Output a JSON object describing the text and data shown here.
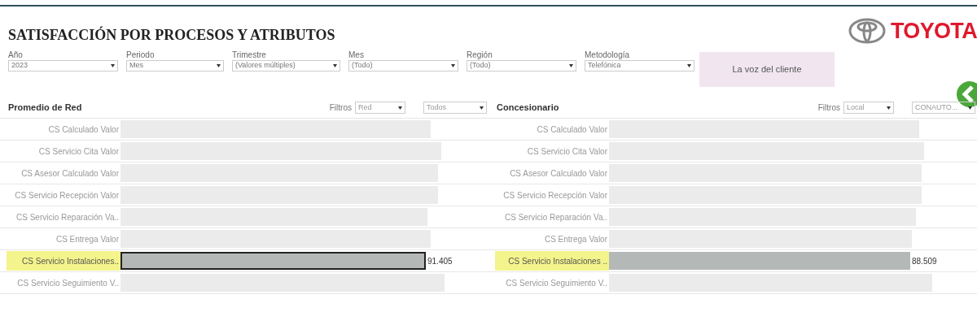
{
  "title": "SATISFACCIÓN POR PROCESOS Y ATRIBUTOS",
  "logo": {
    "text": "TOYOTA"
  },
  "filters": [
    {
      "label": "Año",
      "value": "2023"
    },
    {
      "label": "Periodo",
      "value": "Mes"
    },
    {
      "label": "Trimestre",
      "value": "(Valores múltiples)"
    },
    {
      "label": "Mes",
      "value": "(Todo)"
    },
    {
      "label": "Región",
      "value": "(Todo)"
    },
    {
      "label": "Metodología",
      "value": "Telefónica"
    }
  ],
  "voice_button": "La voz del cliente",
  "panels": [
    {
      "title": "Promedio de Red",
      "filters_label": "Filtros",
      "dropdowns": [
        "Red",
        "Todos"
      ],
      "rows": [
        {
          "label": "CS Calculado Valor",
          "selected": false
        },
        {
          "label": "CS Servicio Cita Valor",
          "selected": false
        },
        {
          "label": "CS Asesor Calculado Valor",
          "selected": false
        },
        {
          "label": "CS Servicio Recepción Valor",
          "selected": false
        },
        {
          "label": "CS Servicio Reparación Va..",
          "selected": false
        },
        {
          "label": "CS Entrega Valor",
          "selected": false
        },
        {
          "label": "CS Servicio Instalaciones..",
          "selected": true,
          "value": "91.405"
        },
        {
          "label": "CS Servicio Seguimiento V..",
          "selected": false
        }
      ]
    },
    {
      "title": "Concesionario",
      "filters_label": "Filtros",
      "dropdowns": [
        "Local",
        "CONAUTO..."
      ],
      "rows": [
        {
          "label": "CS Calculado Valor",
          "selected": false
        },
        {
          "label": "CS Servicio Cita Valor",
          "selected": false
        },
        {
          "label": "CS Asesor Calculado Valor",
          "selected": false
        },
        {
          "label": "CS Servicio Recepción Valor",
          "selected": false
        },
        {
          "label": "CS Servicio Reparación Va..",
          "selected": false
        },
        {
          "label": "CS Entrega Valor",
          "selected": false
        },
        {
          "label": "CS Servicio Instalaciones ..",
          "selected": true,
          "value": "88.509"
        },
        {
          "label": "CS Servicio Seguimiento V..",
          "selected": false
        }
      ]
    }
  ]
}
